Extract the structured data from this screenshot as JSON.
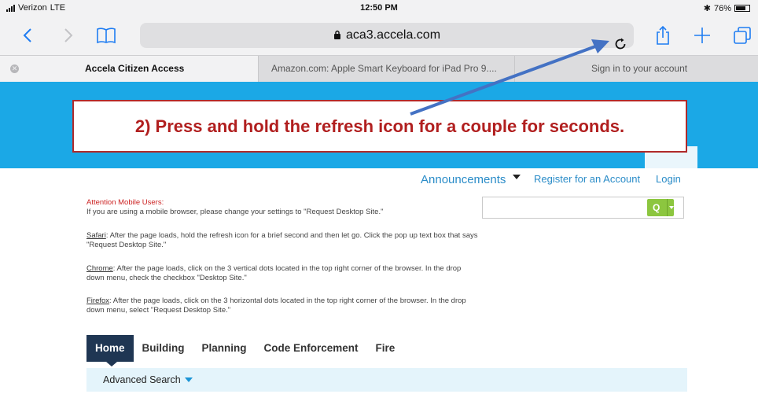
{
  "status_bar": {
    "carrier": "Verizon",
    "network": "LTE",
    "time": "12:50 PM",
    "battery": "76%",
    "battery_level": 0.76
  },
  "browser": {
    "url": "aca3.accela.com",
    "accent_color": "#1e7cf2"
  },
  "tabs": [
    {
      "title": "Accela Citizen Access",
      "active": true
    },
    {
      "title": "Amazon.com: Apple Smart Keyboard for iPad Pro 9....",
      "active": false
    },
    {
      "title": "Sign in to your account",
      "active": false
    }
  ],
  "callout": {
    "text": "2) Press and hold the refresh icon for a couple for seconds.",
    "border_color": "#b02a2a"
  },
  "site": {
    "hero_color": "#1ba8e6",
    "topnav": {
      "announcements": "Announcements",
      "register": "Register for an Account",
      "login": "Login"
    },
    "search": {
      "button_label": "Q"
    },
    "notice": {
      "heading": "Attention Mobile Users:",
      "intro": "If you are using a mobile browser, please change your settings to \"Request Desktop Site.\"",
      "safari_label": "Safari",
      "safari_text": ": After the page loads, hold the refresh icon for a brief second and then let go. Click the pop up text box that says \"Request Desktop Site.\"",
      "chrome_label": "Chrome",
      "chrome_text": ": After the page loads, click on the 3 vertical dots located in the top right corner of the browser. In the drop down menu, check the checkbox \"Desktop Site.\"",
      "firefox_label": "Firefox",
      "firefox_text": ": After the page loads, click on the 3 horizontal dots located in the top right corner of the browser. In the drop down menu, select \"Request Desktop Site.\""
    },
    "main_nav": [
      "Home",
      "Building",
      "Planning",
      "Code Enforcement",
      "Fire"
    ],
    "subnav_label": "Advanced Search"
  }
}
